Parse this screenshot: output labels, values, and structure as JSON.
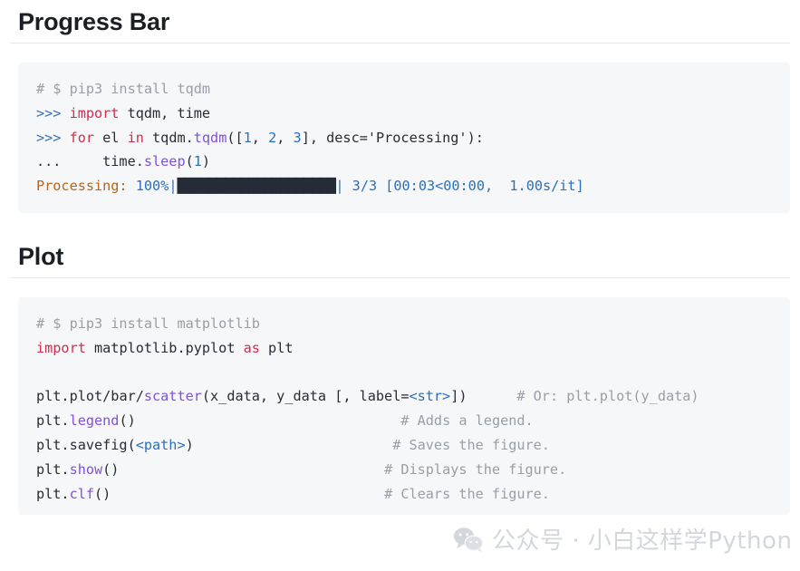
{
  "sections": [
    {
      "id": "progress-bar",
      "heading": "Progress Bar",
      "code_lines": [
        {
          "id": "pb-l1",
          "tokens": [
            {
              "t": "# $ pip3 install tqdm",
              "c": "c-comment"
            }
          ]
        },
        {
          "id": "pb-l2",
          "tokens": [
            {
              "t": ">>> ",
              "c": "c-prompt"
            },
            {
              "t": "import",
              "c": "c-kw"
            },
            {
              "t": " tqdm, time",
              "c": "c-plain"
            }
          ]
        },
        {
          "id": "pb-l3",
          "tokens": [
            {
              "t": ">>> ",
              "c": "c-prompt"
            },
            {
              "t": "for",
              "c": "c-kw"
            },
            {
              "t": " el ",
              "c": "c-plain"
            },
            {
              "t": "in",
              "c": "c-kw"
            },
            {
              "t": " tqdm.",
              "c": "c-plain"
            },
            {
              "t": "tqdm",
              "c": "c-fn"
            },
            {
              "t": "([",
              "c": "c-plain"
            },
            {
              "t": "1",
              "c": "c-num"
            },
            {
              "t": ", ",
              "c": "c-plain"
            },
            {
              "t": "2",
              "c": "c-num"
            },
            {
              "t": ", ",
              "c": "c-plain"
            },
            {
              "t": "3",
              "c": "c-num"
            },
            {
              "t": "], desc='Processing'):",
              "c": "c-plain"
            }
          ]
        },
        {
          "id": "pb-l4",
          "tokens": [
            {
              "t": "...     time.",
              "c": "c-plain"
            },
            {
              "t": "sleep",
              "c": "c-fn"
            },
            {
              "t": "(",
              "c": "c-plain"
            },
            {
              "t": "1",
              "c": "c-num"
            },
            {
              "t": ")",
              "c": "c-plain"
            }
          ]
        },
        {
          "id": "pb-l5",
          "tokens": [
            {
              "t": "Processing:",
              "c": "c-orange"
            },
            {
              "t": " ",
              "c": "c-plain"
            },
            {
              "t": "100%",
              "c": "c-blue"
            },
            {
              "t": "|",
              "c": "c-pipe"
            },
            {
              "t": "████████████████████",
              "c": "c-bar"
            },
            {
              "t": "|",
              "c": "c-pipe"
            },
            {
              "t": " ",
              "c": "c-plain"
            },
            {
              "t": "3/3 [00:03<00:00,  1.00s/it]",
              "c": "c-blue"
            }
          ]
        }
      ]
    },
    {
      "id": "plot",
      "heading": "Plot",
      "code_lines": [
        {
          "id": "pl-l1",
          "tokens": [
            {
              "t": "# $ pip3 install matplotlib",
              "c": "c-comment"
            }
          ]
        },
        {
          "id": "pl-l2",
          "tokens": [
            {
              "t": "import",
              "c": "c-kw"
            },
            {
              "t": " matplotlib.pyplot ",
              "c": "c-plain"
            },
            {
              "t": "as",
              "c": "c-kw"
            },
            {
              "t": " plt",
              "c": "c-plain"
            }
          ]
        },
        {
          "id": "pl-l3",
          "tokens": []
        },
        {
          "id": "pl-l4",
          "tokens": [
            {
              "t": "plt.",
              "c": "c-plain"
            },
            {
              "t": "plot",
              "c": "c-plain"
            },
            {
              "t": "/bar/",
              "c": "c-plain"
            },
            {
              "t": "scatter",
              "c": "c-fn"
            },
            {
              "t": "(x_data, y_data [, label=",
              "c": "c-plain"
            },
            {
              "t": "<str>",
              "c": "c-blue"
            },
            {
              "t": "])",
              "c": "c-plain"
            },
            {
              "t": "      ",
              "c": "c-plain"
            },
            {
              "t": "# Or: plt.plot(y_data)",
              "c": "c-comment"
            }
          ]
        },
        {
          "id": "pl-l5",
          "tokens": [
            {
              "t": "plt.",
              "c": "c-plain"
            },
            {
              "t": "legend",
              "c": "c-fn"
            },
            {
              "t": "()",
              "c": "c-plain"
            },
            {
              "t": "                                ",
              "c": "c-plain"
            },
            {
              "t": "# Adds a legend.",
              "c": "c-comment"
            }
          ]
        },
        {
          "id": "pl-l6",
          "tokens": [
            {
              "t": "plt.savefig(",
              "c": "c-plain"
            },
            {
              "t": "<path>",
              "c": "c-blue"
            },
            {
              "t": ")",
              "c": "c-plain"
            },
            {
              "t": "                        ",
              "c": "c-plain"
            },
            {
              "t": "# Saves the figure.",
              "c": "c-comment"
            }
          ]
        },
        {
          "id": "pl-l7",
          "tokens": [
            {
              "t": "plt.",
              "c": "c-plain"
            },
            {
              "t": "show",
              "c": "c-fn"
            },
            {
              "t": "()",
              "c": "c-plain"
            },
            {
              "t": "                                ",
              "c": "c-plain"
            },
            {
              "t": "# Displays the figure.",
              "c": "c-comment"
            }
          ]
        },
        {
          "id": "pl-l8",
          "tokens": [
            {
              "t": "plt.",
              "c": "c-plain"
            },
            {
              "t": "clf",
              "c": "c-fn"
            },
            {
              "t": "()",
              "c": "c-plain"
            },
            {
              "t": "                                 ",
              "c": "c-plain"
            },
            {
              "t": "# Clears the figure.",
              "c": "c-comment"
            }
          ]
        }
      ]
    }
  ],
  "watermark": {
    "icon": "wechat-icon",
    "text": "公众号 · 小白这样学Python"
  },
  "colors": {
    "page_background": "#ffffff",
    "code_background": "#f5f7f9",
    "heading_text": "#1b1f23",
    "heading_rule": "#e6e8ea",
    "comment": "#999fa6",
    "keyword": "#cf2f4e",
    "function": "#8250df",
    "number": "#2c6fbb",
    "prompt": "#3b6fb6",
    "progress_label": "#b5651d",
    "progress_bar": "#262b38",
    "watermark_text": "#b9bec4"
  }
}
